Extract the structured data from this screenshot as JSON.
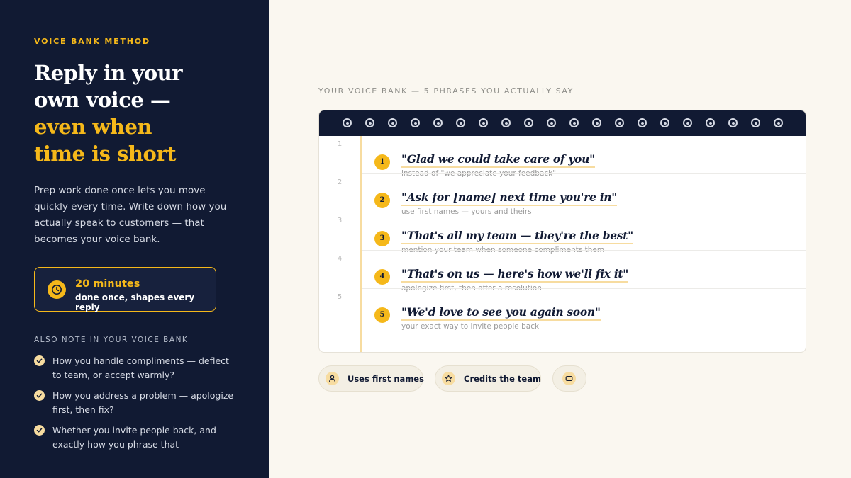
{
  "sidebar": {
    "eyebrow": "VOICE BANK METHOD",
    "headline_white": [
      "Reply in your",
      "own voice —"
    ],
    "headline_accent": [
      "even when",
      "time is short"
    ],
    "lead": "Prep work done once lets you move quickly every time. Write down how you actually speak to customers — that becomes your voice bank.",
    "time_box": {
      "icon": "clock-icon",
      "value": "20 minutes",
      "caption": "done once, shapes every reply"
    },
    "also_label": "ALSO NOTE IN YOUR VOICE BANK",
    "notes": [
      "How you handle compliments — deflect to team, or accept warmly?",
      "How you address a problem — apologize first, then fix?",
      "Whether you invite people back, and exactly how you phrase that"
    ]
  },
  "voice_bank": {
    "label": "YOUR VOICE BANK — 5 PHRASES YOU ACTUALLY SAY",
    "phrases": [
      {
        "line": "1",
        "num": "1",
        "text": "\"Glad we could take care of you\"",
        "hint": "instead of \"we appreciate your feedback\""
      },
      {
        "line": "2",
        "num": "2",
        "text": "\"Ask for [name] next time you're in\"",
        "hint": "use first names — yours and theirs"
      },
      {
        "line": "3",
        "num": "3",
        "text": "\"That's all my team — they're the best\"",
        "hint": "mention your team when someone compliments them"
      },
      {
        "line": "4",
        "num": "4",
        "text": "\"That's on us — here's how we'll fix it\"",
        "hint": "apologize first, then offer a resolution"
      },
      {
        "line": "5",
        "num": "5",
        "text": "\"We'd love to see you again soon\"",
        "hint": "your exact way to invite people back"
      }
    ]
  },
  "chips": [
    {
      "label": "Uses first names",
      "icon": "person-icon"
    },
    {
      "label": "Credits the team",
      "icon": "star-icon"
    },
    {
      "label": "",
      "icon": "rectangle-icon"
    }
  ],
  "colors": {
    "navy": "#111a33",
    "accent": "#f5b81a",
    "cream": "#faf7f0",
    "soft_yellow": "#f7dca0"
  }
}
